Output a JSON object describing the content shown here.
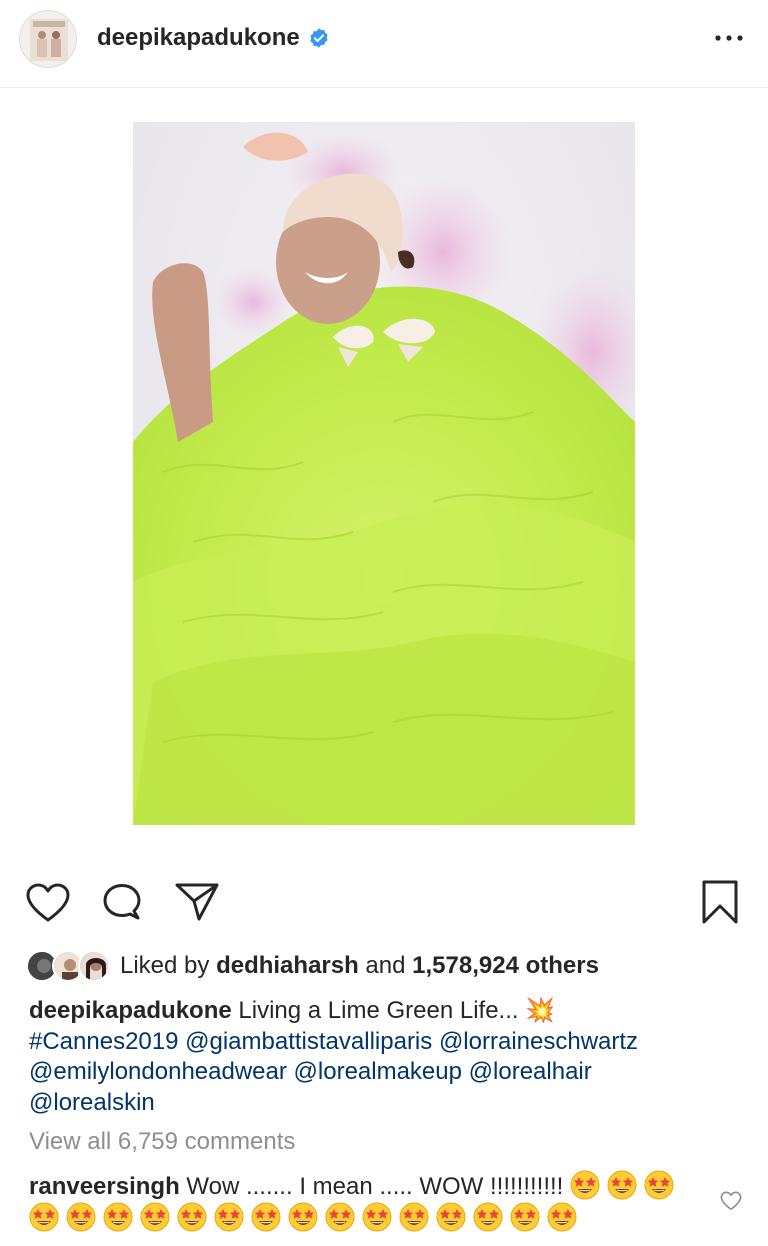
{
  "post": {
    "username": "deepikapadukone",
    "verified": true
  },
  "actions": {
    "like": "heart-icon",
    "comment": "comment-icon",
    "share": "share-icon",
    "save": "bookmark-icon"
  },
  "likes": {
    "prefix": "Liked by ",
    "user": "dedhiaharsh",
    "middle": " and ",
    "count": "1,578,924 others"
  },
  "caption": {
    "username": "deepikapadukone",
    "text": " Living a Lime Green Life... ",
    "emoji": "💥",
    "tags": [
      "#Cannes2019",
      "@giambattistavalliparis",
      "@lorraineschwartz",
      "@emilylondonheadwear",
      "@lorealmakeup",
      "@lorealhair",
      "@lorealskin"
    ]
  },
  "view_all_comments": "View all 6,759 comments",
  "comment": {
    "username": "ranveersingh",
    "text": " Wow ....... I mean ..... WOW !!!!!!!!!!! ",
    "emoji_count": 18
  },
  "colors": {
    "link": "#003569",
    "verified": "#3897f0",
    "muted": "#8e8e8e",
    "text": "#262626"
  }
}
